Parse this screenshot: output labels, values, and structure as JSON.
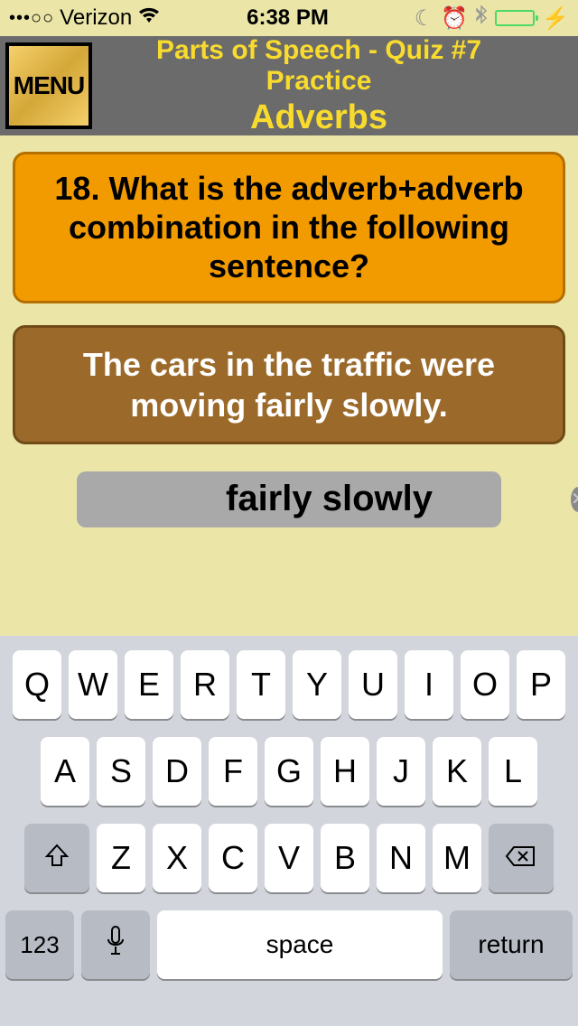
{
  "status": {
    "carrier": "Verizon",
    "time": "6:38 PM",
    "signal_dots": "•••○○"
  },
  "header": {
    "menu_label": "MENU",
    "title_line1": "Parts of Speech - Quiz #7 Practice",
    "title_line2": "Adverbs"
  },
  "question": {
    "text": "18. What is the adverb+adverb combination in the following sentence?"
  },
  "sentence": {
    "text": "The cars in the traffic were moving fairly slowly."
  },
  "answer": {
    "value": "fairly slowly"
  },
  "keyboard": {
    "row1": [
      "Q",
      "W",
      "E",
      "R",
      "T",
      "Y",
      "U",
      "I",
      "O",
      "P"
    ],
    "row2": [
      "A",
      "S",
      "D",
      "F",
      "G",
      "H",
      "J",
      "K",
      "L"
    ],
    "row3": [
      "Z",
      "X",
      "C",
      "V",
      "B",
      "N",
      "M"
    ],
    "numKey": "123",
    "space": "space",
    "return": "return"
  }
}
